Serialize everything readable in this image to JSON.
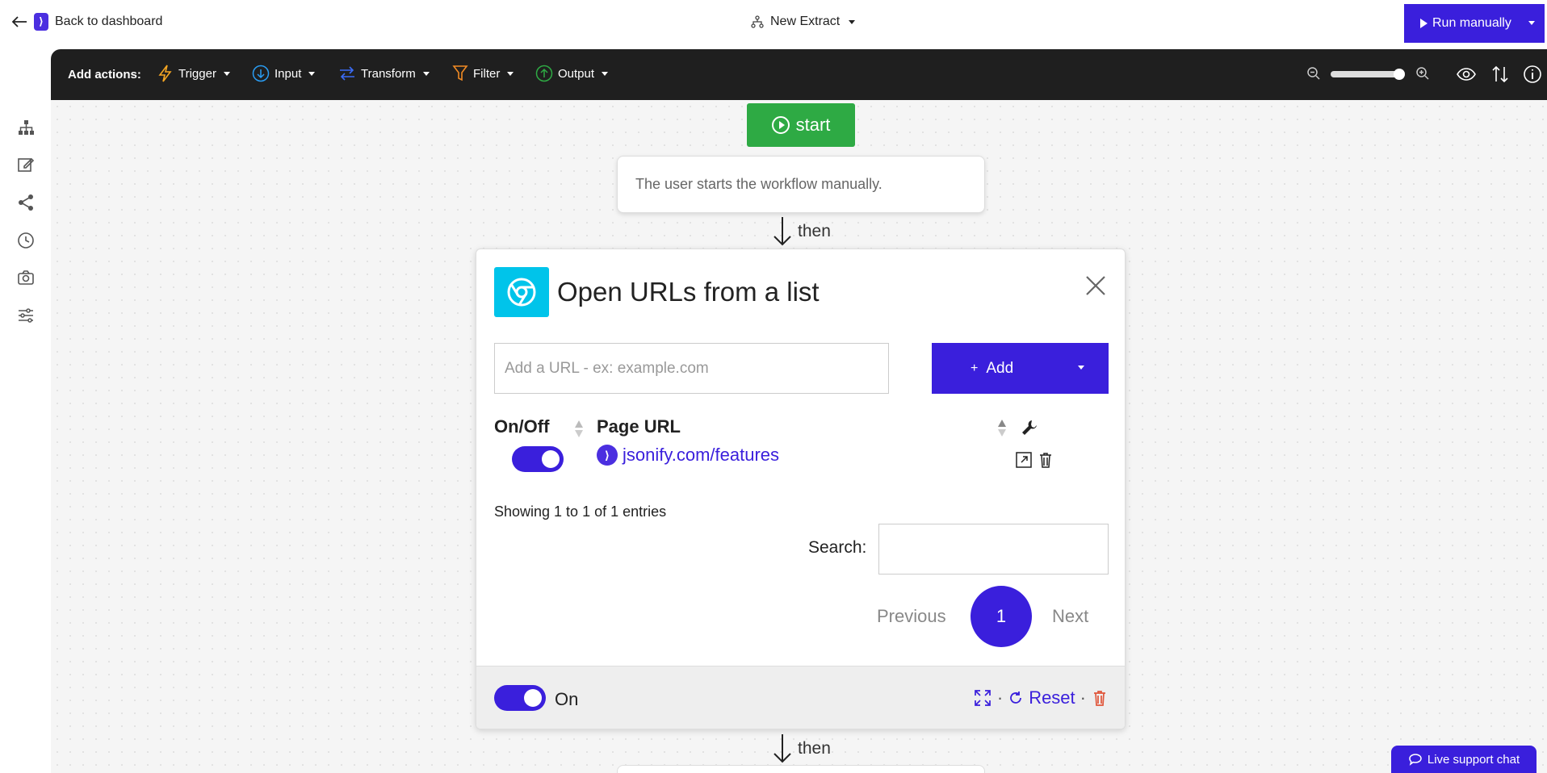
{
  "header": {
    "back_label": "Back to dashboard",
    "extract_label": "New Extract",
    "run_label": "Run manually"
  },
  "sidebar": {
    "icons": [
      "sitemap-icon",
      "edit-icon",
      "share-icon",
      "history-icon",
      "camera-icon",
      "sliders-icon"
    ]
  },
  "actionbar": {
    "label": "Add actions:",
    "items": [
      {
        "label": "Trigger",
        "icon": "lightning-icon",
        "color": "#f5a623"
      },
      {
        "label": "Input",
        "icon": "arrow-down-circle-icon",
        "color": "#2a9df4"
      },
      {
        "label": "Transform",
        "icon": "transform-arrows-icon",
        "color": "#3b6cf5"
      },
      {
        "label": "Filter",
        "icon": "funnel-icon",
        "color": "#f08a24"
      },
      {
        "label": "Output",
        "icon": "arrow-up-circle-icon",
        "color": "#2eaa44"
      }
    ]
  },
  "workflow": {
    "start_label": "start",
    "start_description": "The user starts the workflow manually.",
    "then_label": "then"
  },
  "card": {
    "title": "Open URLs from a list",
    "url_placeholder": "Add a URL - ex: example.com",
    "add_label": "Add",
    "col_onoff": "On/Off",
    "col_url": "Page URL",
    "row_url": "jsonify.com/features",
    "showing": "Showing 1 to 1 of 1 entries",
    "search_label": "Search:",
    "prev_label": "Previous",
    "page_number": "1",
    "next_label": "Next",
    "footer_on": "On",
    "reset_label": "Reset"
  },
  "chat": {
    "label": "Live support chat"
  },
  "colors": {
    "accent": "#3a1fdc",
    "start_green": "#2eaa44",
    "chrome_icon_bg": "#00c4ea"
  }
}
